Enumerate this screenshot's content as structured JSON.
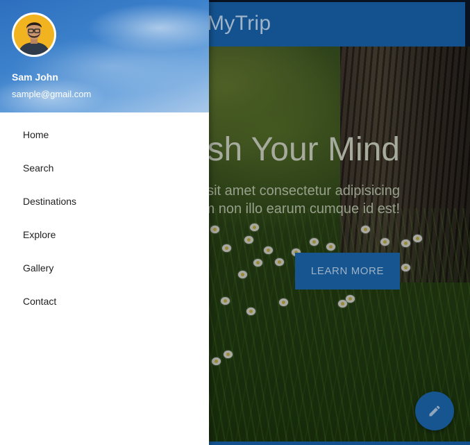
{
  "appbar": {
    "title": "MyTrip"
  },
  "hero": {
    "heading": "Refresh Your Mind",
    "text": "Lorem ipsum dolor sit amet consectetur adipisicing elit. Rerum non illo earum cumque id est!",
    "button_label": "LEARN MORE"
  },
  "fab": {
    "icon": "pencil-icon"
  },
  "drawer": {
    "user": {
      "name": "Sam John",
      "email": "sample@gmail.com"
    },
    "items": [
      {
        "label": "Home"
      },
      {
        "label": "Search"
      },
      {
        "label": "Destinations"
      },
      {
        "label": "Explore"
      },
      {
        "label": "Gallery"
      },
      {
        "label": "Contact"
      }
    ]
  },
  "colors": {
    "primary": "#14528f",
    "drawer_bg": "#ffffff",
    "nav_text": "#212121"
  }
}
